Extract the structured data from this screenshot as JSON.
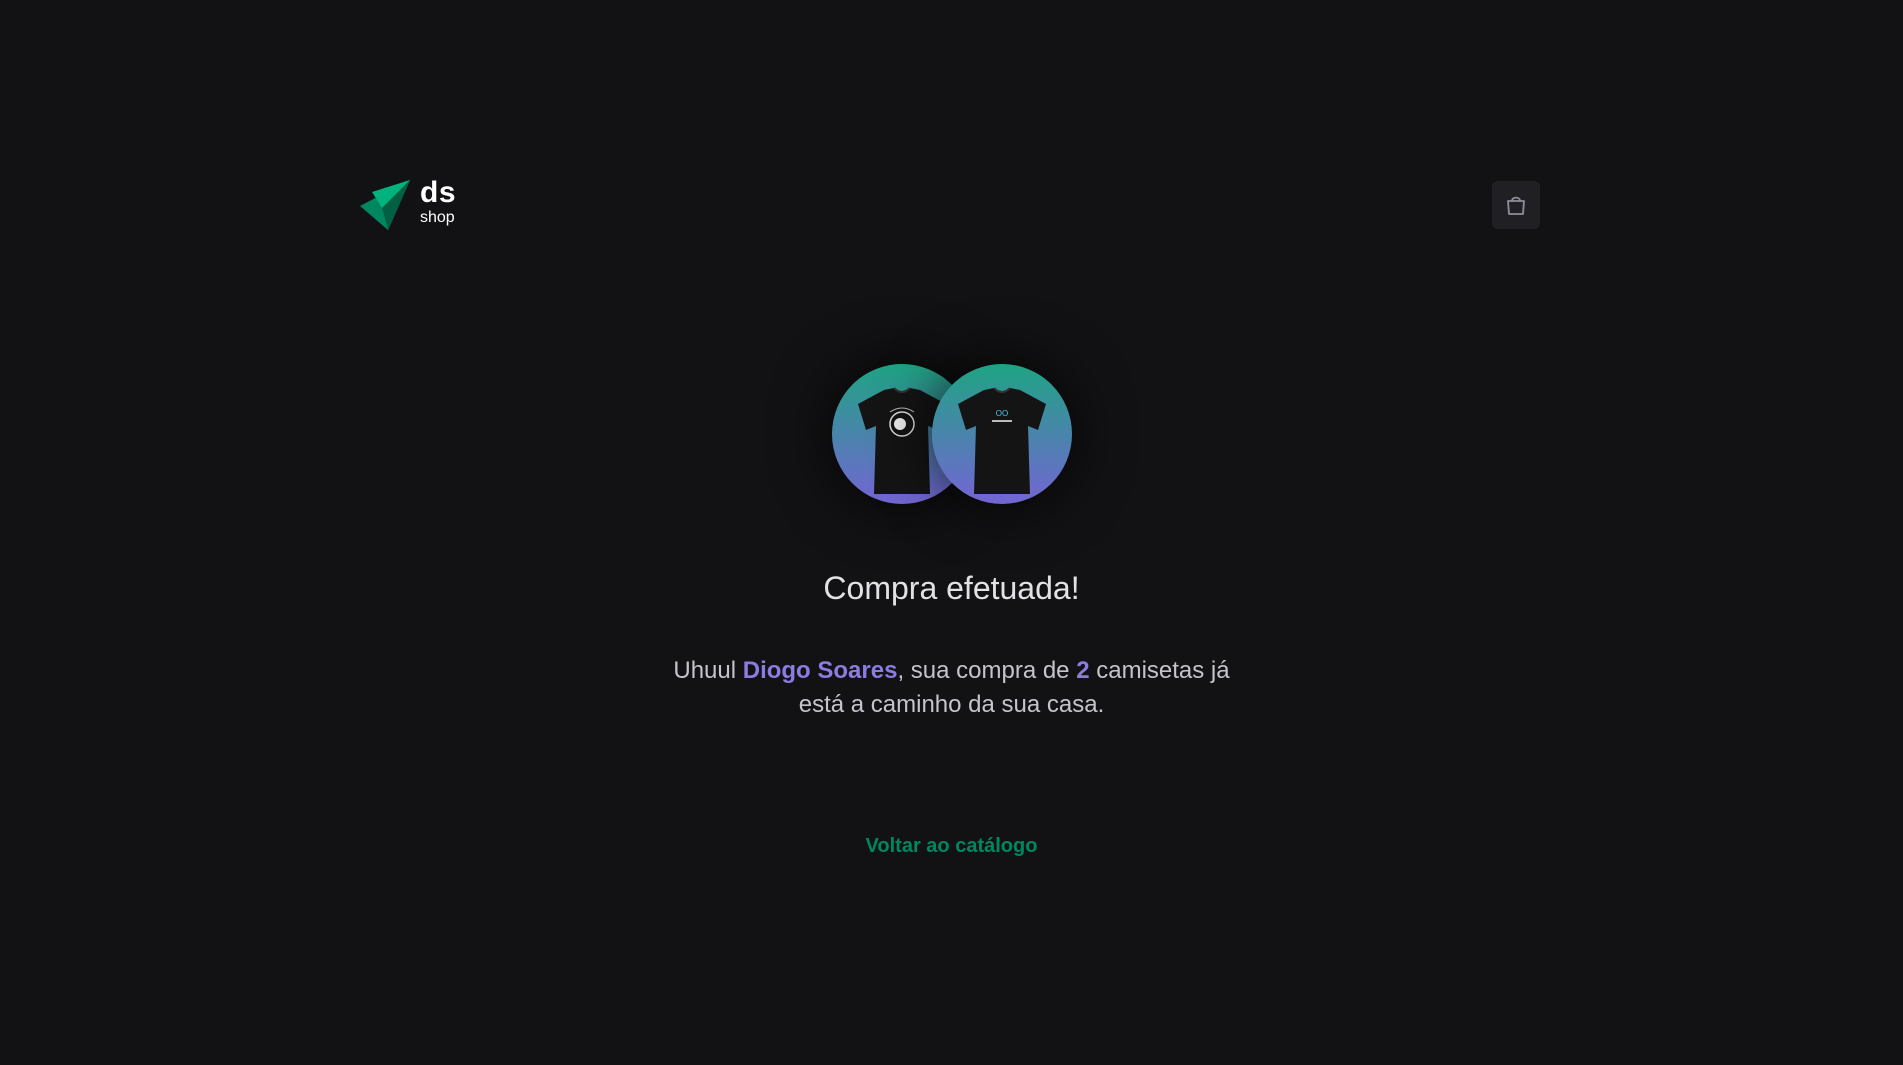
{
  "brand": {
    "name": "ds",
    "subtitle": "shop",
    "accent_color": "#00875f",
    "accent_dark": "#015f43"
  },
  "header": {
    "cart_icon": "shopping-bag-icon"
  },
  "main": {
    "product_thumbnails": [
      {
        "icon": "tshirt-icon"
      },
      {
        "icon": "tshirt-icon"
      }
    ],
    "title": "Compra efetuada!",
    "message": {
      "prefix": "Uhuul ",
      "customer_name": "Diogo Soares",
      "middle": ", sua compra de ",
      "quantity": "2",
      "suffix": " camisetas já está a caminho da sua casa."
    },
    "back_link": "Voltar ao catálogo"
  },
  "colors": {
    "background": "#121214",
    "title_text": "#e1e1e6",
    "body_text": "#c4c4cc",
    "highlight": "#8a7ce0",
    "link": "#00875f",
    "gradient_top": "#1ea483",
    "gradient_bottom": "#7465d4"
  }
}
